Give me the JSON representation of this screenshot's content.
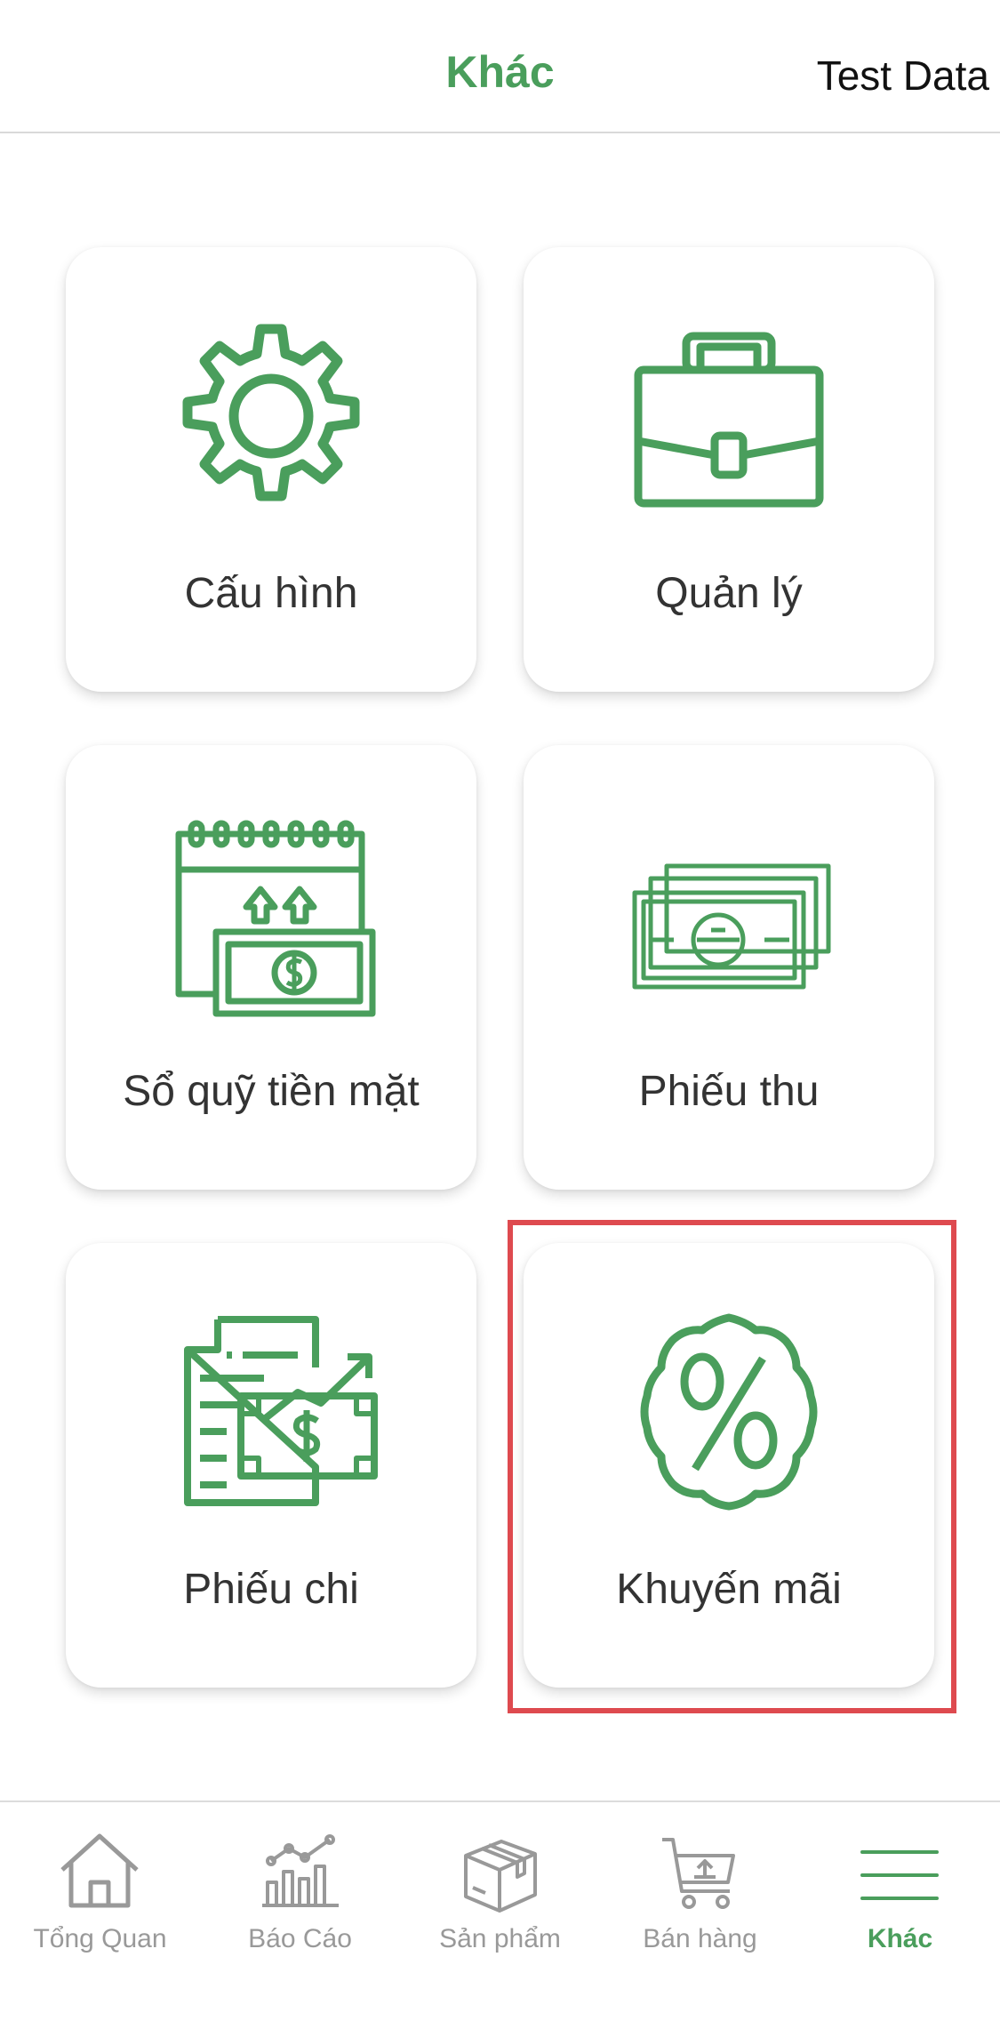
{
  "header": {
    "title": "Khác",
    "right_text": "Test Data"
  },
  "tiles": [
    {
      "label": "Cấu hình",
      "icon": "gear-icon"
    },
    {
      "label": "Quản lý",
      "icon": "briefcase-icon"
    },
    {
      "label": "Sổ quỹ tiền mặt",
      "icon": "cashbook-icon"
    },
    {
      "label": "Phiếu thu",
      "icon": "banknotes-icon"
    },
    {
      "label": "Phiếu chi",
      "icon": "expense-voucher-icon"
    },
    {
      "label": "Khuyến mãi",
      "icon": "percent-badge-icon"
    }
  ],
  "tabbar": {
    "items": [
      {
        "label": "Tổng Quan",
        "icon": "home-icon"
      },
      {
        "label": "Báo Cáo",
        "icon": "chart-icon"
      },
      {
        "label": "Sản phẩm",
        "icon": "box-icon"
      },
      {
        "label": "Bán hàng",
        "icon": "cart-icon"
      },
      {
        "label": "Khác",
        "icon": "menu-icon",
        "active": true
      }
    ]
  },
  "colors": {
    "accent": "#4a9e5c",
    "inactive": "#999999",
    "highlight": "#de4a4f"
  }
}
